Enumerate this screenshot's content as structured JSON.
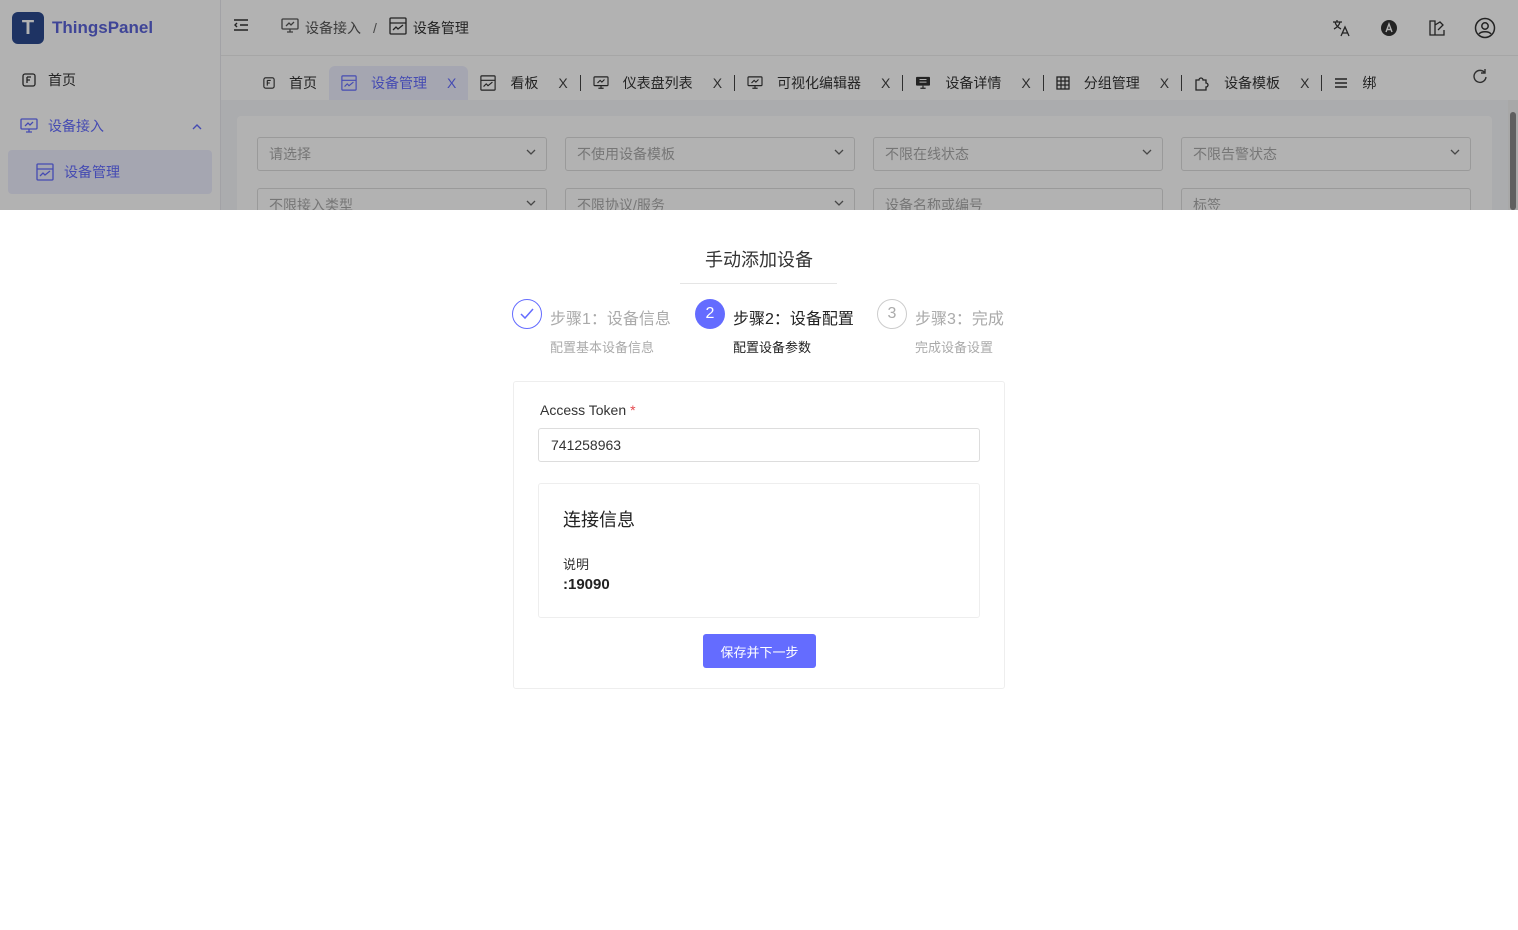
{
  "app": {
    "logo_letter": "T",
    "name": "ThingsPanel"
  },
  "sidebar": {
    "items": [
      {
        "label": "首页",
        "icon": "f-box-icon"
      },
      {
        "label": "设备接入",
        "icon": "monitor-icon"
      },
      {
        "label": "设备管理",
        "icon": "chart-screen-icon"
      }
    ]
  },
  "header": {
    "breadcrumbs": [
      "设备接入",
      "设备管理"
    ],
    "separator": "/"
  },
  "tabs": [
    {
      "label": "首页",
      "icon": "f-box-icon"
    },
    {
      "label": "设备管理",
      "icon": "chart-screen-icon"
    },
    {
      "label": "看板",
      "icon": "chart-screen-icon"
    },
    {
      "label": "仪表盘列表",
      "icon": "monitor-icon"
    },
    {
      "label": "可视化编辑器",
      "icon": "monitor-icon"
    },
    {
      "label": "设备详情",
      "icon": "monitor-icon"
    },
    {
      "label": "分组管理",
      "icon": "grid-icon"
    },
    {
      "label": "设备模板",
      "icon": "puzzle-icon"
    },
    {
      "label": "绑",
      "icon": "menu-icon"
    }
  ],
  "tab_close": "X",
  "filters": [
    {
      "placeholder": "请选择"
    },
    {
      "placeholder": "不使用设备模板"
    },
    {
      "placeholder": "不限在线状态"
    },
    {
      "placeholder": "不限告警状态"
    },
    {
      "placeholder": "不限接入类型"
    },
    {
      "placeholder": "不限协议/服务"
    },
    {
      "placeholder": "设备名称或编号"
    },
    {
      "placeholder": "标签"
    }
  ],
  "dialog": {
    "title": "手动添加设备",
    "steps": [
      {
        "number": "1",
        "title": "步骤1：设备信息",
        "desc": "配置基本设备信息",
        "status": "done"
      },
      {
        "number": "2",
        "title": "步骤2：设备配置",
        "desc": "配置设备参数",
        "status": "current"
      },
      {
        "number": "3",
        "title": "步骤3：完成",
        "desc": "完成设备设置",
        "status": "todo"
      }
    ],
    "token_label": "Access Token",
    "token_required": "*",
    "token_value": "741258963",
    "conn": {
      "title": "连接信息",
      "key": "说明",
      "value": ":19090"
    },
    "next_button": "保存并下一步"
  },
  "colors": {
    "accent": "#646cff",
    "required": "#e5484d"
  }
}
